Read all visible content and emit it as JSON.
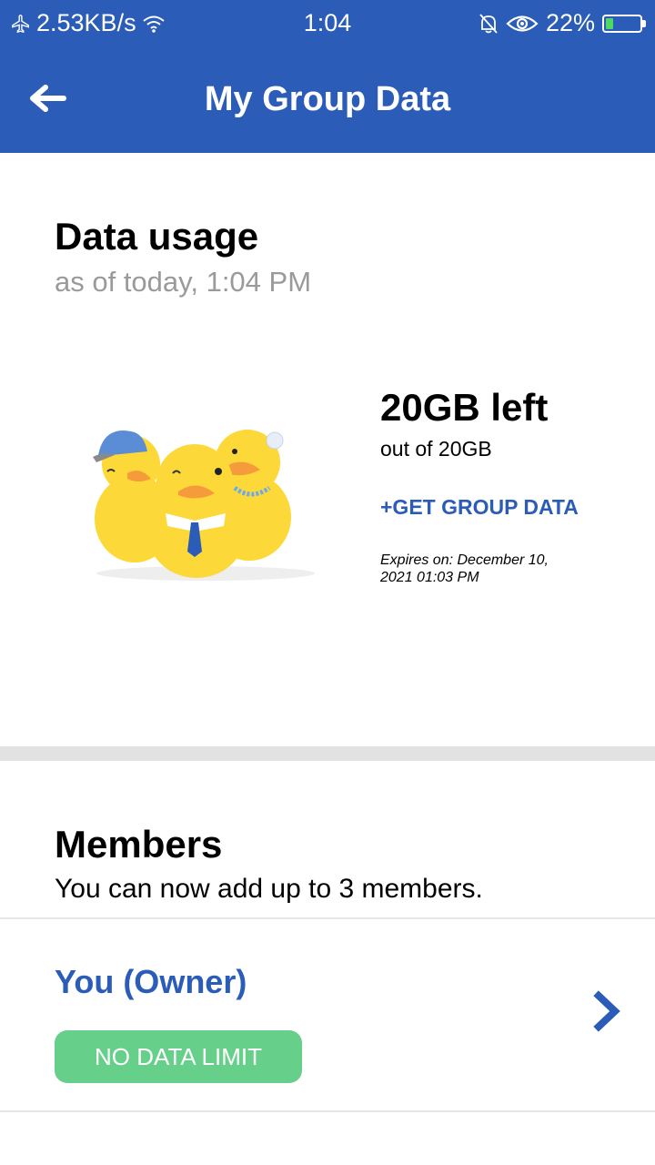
{
  "status_bar": {
    "net_speed": "2.53KB/s",
    "time": "1:04",
    "battery_percent": "22%",
    "battery_level": 0.22,
    "icons": [
      "airplane-icon",
      "wifi-icon",
      "alarm-off-icon",
      "eye-icon",
      "battery-icon"
    ]
  },
  "app_bar": {
    "title": "My Group Data",
    "back_icon": "arrow-left-icon"
  },
  "usage": {
    "title": "Data usage",
    "as_of": "as of today, 1:04 PM",
    "remaining": "20GB left",
    "total": "out of 20GB",
    "get_group_data": "+GET GROUP DATA",
    "expires": "Expires on: December 10, 2021 01:03 PM",
    "illustration": "ducks-illustration"
  },
  "members": {
    "title": "Members",
    "subtitle": "You can now add up to 3 members.",
    "items": [
      {
        "name": "You (Owner)",
        "badge": "NO DATA LIMIT",
        "chevron": "chevron-right-icon"
      }
    ]
  },
  "colors": {
    "primary": "#2a5cb8",
    "badge_green": "#66cf8a",
    "divider": "#e2e2e2",
    "subtext": "#9a9a9a"
  }
}
